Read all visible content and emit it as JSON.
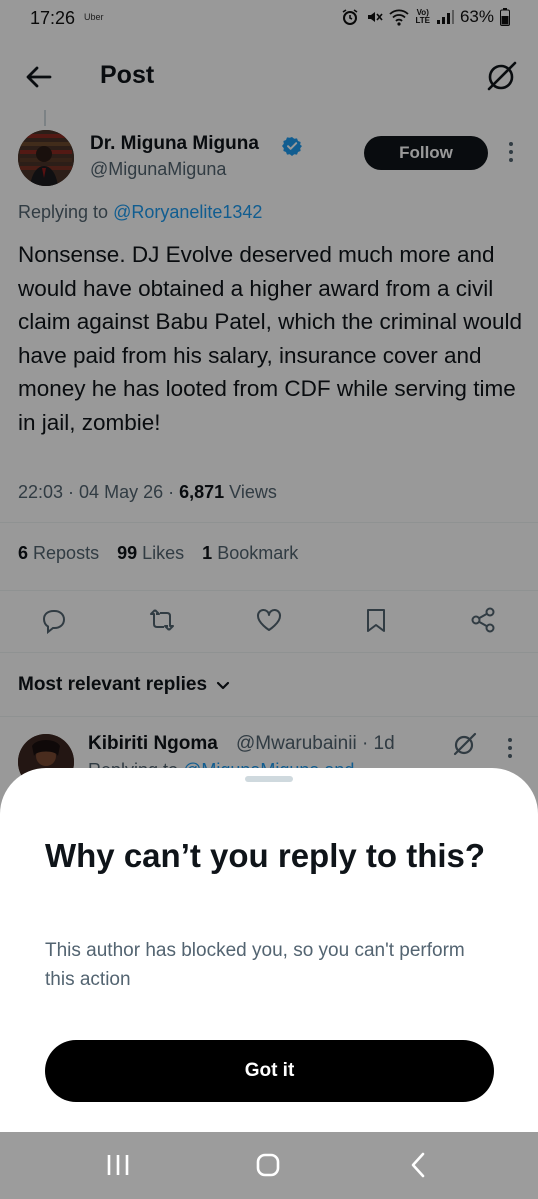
{
  "status_bar": {
    "time": "17:26",
    "carrier_app": "Uber",
    "lte_label": "Vo)\nLTE",
    "battery": "63%"
  },
  "header": {
    "title": "Post"
  },
  "post": {
    "author_name": "Dr. Miguna Miguna",
    "author_handle": "@MigunaMiguna",
    "follow_label": "Follow",
    "replying_prefix": "Replying to ",
    "replying_handle": "@Roryanelite1342",
    "text": "Nonsense. DJ Evolve deserved much more and would have obtained a higher award from a civil claim against Babu Patel, which the criminal would have paid from his salary, insurance cover and money he has looted from CDF while serving time in jail, zombie!",
    "time": "22:03",
    "date": "04 May 26",
    "views_count": "6,871",
    "views_label": "Views",
    "stats": {
      "reposts_count": "6",
      "reposts_label": "Reposts",
      "likes_count": "99",
      "likes_label": "Likes",
      "bookmarks_count": "1",
      "bookmarks_label": "Bookmark"
    }
  },
  "replies": {
    "sort_label": "Most relevant replies",
    "first_reply": {
      "name": "Kibiriti Ngoma",
      "handle_time": "@Mwarubainii · 1d",
      "sub_prefix": "Replying to ",
      "sub_handle": "@MigunaMiguna and"
    }
  },
  "sheet": {
    "title": "Why can’t you reply to this?",
    "body": "This author has blocked you, so you can't perform this action",
    "button_label": "Got it"
  },
  "colors": {
    "accent": "#1d9bf0",
    "text_primary": "#0f1419",
    "text_secondary": "#536471",
    "nav_bar": "#9c9c9c"
  }
}
